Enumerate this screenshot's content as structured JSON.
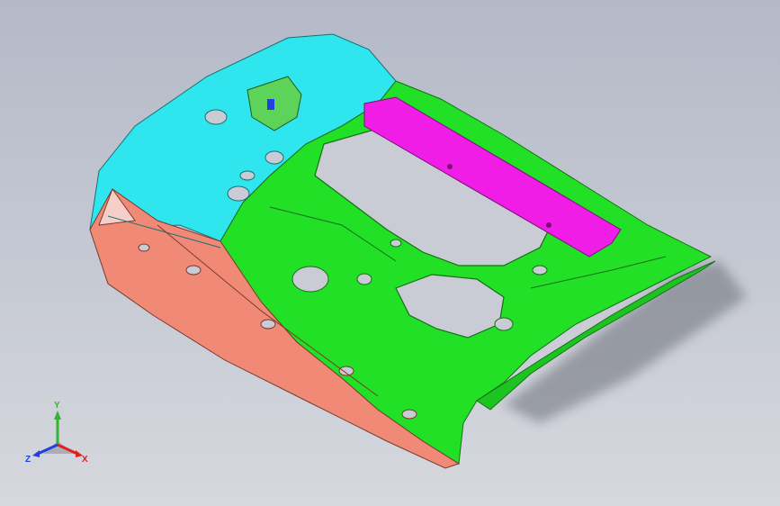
{
  "triad": {
    "x_label": "X",
    "y_label": "Y",
    "z_label": "Z",
    "x_color": "#e02020",
    "y_color": "#2fb52f",
    "z_color": "#2040e0"
  },
  "model": {
    "part_colors": {
      "front_panel": "#f08a76",
      "left_panel": "#2fe6ee",
      "main_panel": "#22e026",
      "bracket_bar": "#ef1de6",
      "holes": "#c9ccd4"
    }
  }
}
